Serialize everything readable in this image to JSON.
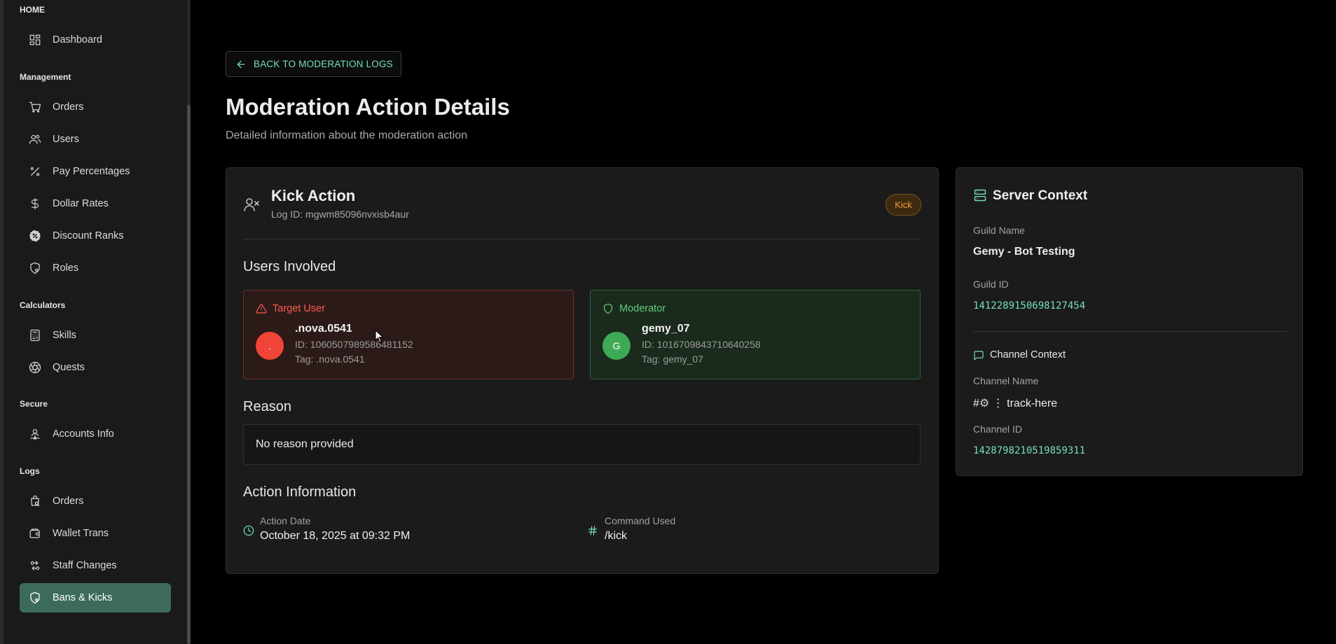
{
  "sidebar": {
    "groups": {
      "home": "HOME",
      "management": "Management",
      "calculators": "Calculators",
      "secure": "Secure",
      "logs": "Logs"
    },
    "items": {
      "dashboard": "Dashboard",
      "orders": "Orders",
      "users": "Users",
      "pay_percentages": "Pay Percentages",
      "dollar_rates": "Dollar Rates",
      "discount_ranks": "Discount Ranks",
      "roles": "Roles",
      "skills": "Skills",
      "quests": "Quests",
      "accounts_info": "Accounts Info",
      "log_orders": "Orders",
      "wallet_trans": "Wallet Trans",
      "staff_changes": "Staff Changes",
      "bans_kicks": "Bans & Kicks"
    },
    "active_item": "Bans & Kicks",
    "active_color": "#3c6b5e"
  },
  "header": {
    "back_label": "BACK TO MODERATION LOGS",
    "title": "Moderation Action Details",
    "subtitle": "Detailed information about the moderation action"
  },
  "action": {
    "title": "Kick Action",
    "log_id": "Log ID: mgwm85096nvxisb4aur",
    "badge": "Kick",
    "users_title": "Users Involved",
    "target": {
      "heading": "Target User",
      "avatar": ".",
      "name": ".nova.0541",
      "id": "ID: 1060507989586481152",
      "tag": "Tag: .nova.0541"
    },
    "moderator": {
      "heading": "Moderator",
      "avatar": "G",
      "name": "gemy_07",
      "id": "ID: 1016709843710640258",
      "tag": "Tag: gemy_07"
    },
    "reason_title": "Reason",
    "reason": "No reason provided",
    "info_title": "Action Information",
    "date_label": "Action Date",
    "date_value": "October 18, 2025 at 09:32 PM",
    "command_label": "Command Used",
    "command_value": "/kick"
  },
  "server": {
    "title": "Server Context",
    "guild_name_label": "Guild Name",
    "guild_name": "Gemy - Bot Testing",
    "guild_id_label": "Guild ID",
    "guild_id": "1412289150698127454",
    "channel_title": "Channel Context",
    "channel_name_label": "Channel Name",
    "channel_prefix": "#",
    "channel_suffix": "⋮ track-here",
    "channel_id_label": "Channel ID",
    "channel_id": "1428798210519859311"
  },
  "colors": {
    "accent": "#74e0bc",
    "danger": "#ff5d4f",
    "success": "#5fd07a",
    "badge": "#f2a03c"
  }
}
